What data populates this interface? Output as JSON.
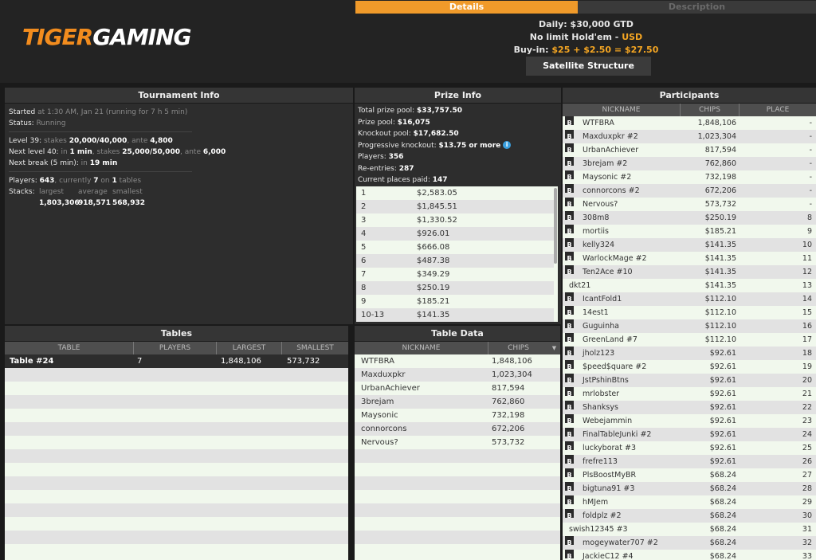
{
  "header": {
    "logo_part1": "TIGER",
    "logo_part2": "GAMING",
    "tab_details": "Details",
    "tab_description": "Description",
    "line1": "Daily: $30,000 GTD",
    "line2_game": "No limit Hold'em - ",
    "line2_currency": "USD",
    "line3_label": "Buy-in: ",
    "line3_value": "$25 + $2.50 = $27.50",
    "satellite_button": "Satellite Structure"
  },
  "tournament_info": {
    "title": "Tournament Info",
    "started_label": "Started",
    "started_value": " at 1:30 AM, Jan 21 (running for 7 h 5 min)",
    "status_label": "Status:",
    "status_value": " Running",
    "level_label": "Level 39:",
    "level_stakes_label": " stakes ",
    "level_stakes": "20,000/40,000",
    "level_ante_label": ", ante ",
    "level_ante": "4,800",
    "next_level_label": "Next level 40:",
    "next_level_in": " in ",
    "next_level_time": "1 min",
    "next_level_stakes_label": ", stakes ",
    "next_level_stakes": "25,000/50,000",
    "next_level_ante_label": ", ante ",
    "next_level_ante": "6,000",
    "next_break_label": "Next break (5 min):",
    "next_break_in": " in ",
    "next_break_time": "19 min",
    "players_label": "Players: ",
    "players_total": "643",
    "players_currently_label": ", currently ",
    "players_current": "7",
    "players_on_label": " on ",
    "players_tables": "1",
    "players_tables_label": " tables",
    "stacks_label": "Stacks:",
    "stacks_largest_label": "largest",
    "stacks_average_label": "average",
    "stacks_smallest_label": "smallest",
    "stacks_largest": "1,803,306",
    "stacks_average": "918,571",
    "stacks_smallest": "568,932"
  },
  "prize_info": {
    "title": "Prize Info",
    "total_prize_pool_label": "Total prize pool: ",
    "total_prize_pool": "$33,757.50",
    "prize_pool_label": "Prize pool: ",
    "prize_pool": "$16,075",
    "knockout_pool_label": "Knockout pool: ",
    "knockout_pool": "$17,682.50",
    "progressive_label": "Progressive knockout: ",
    "progressive_value": "$13.75 or more",
    "players_label": "Players: ",
    "players": "356",
    "reentries_label": "Re-entries: ",
    "reentries": "287",
    "places_paid_label": "Current places paid: ",
    "places_paid": "147",
    "payouts": [
      {
        "place": "1",
        "amount": "$2,583.05"
      },
      {
        "place": "2",
        "amount": "$1,845.51"
      },
      {
        "place": "3",
        "amount": "$1,330.52"
      },
      {
        "place": "4",
        "amount": "$926.01"
      },
      {
        "place": "5",
        "amount": "$666.08"
      },
      {
        "place": "6",
        "amount": "$487.38"
      },
      {
        "place": "7",
        "amount": "$349.29"
      },
      {
        "place": "8",
        "amount": "$250.19"
      },
      {
        "place": "9",
        "amount": "$185.21"
      },
      {
        "place": "10-13",
        "amount": "$141.35"
      }
    ]
  },
  "tables": {
    "title": "Tables",
    "columns": [
      "TABLE",
      "PLAYERS",
      "LARGEST",
      "SMALLEST"
    ],
    "rows": [
      {
        "table": "Table #24",
        "players": "7",
        "largest": "1,848,106",
        "smallest": "573,732"
      }
    ]
  },
  "table_data": {
    "title": "Table Data",
    "columns": [
      "NICKNAME",
      "CHIPS"
    ],
    "rows": [
      {
        "nickname": "WTFBRA",
        "chips": "1,848,106"
      },
      {
        "nickname": "Maxduxpkr",
        "chips": "1,023,304"
      },
      {
        "nickname": "UrbanAchiever",
        "chips": "817,594"
      },
      {
        "nickname": "3brejam",
        "chips": "762,860"
      },
      {
        "nickname": "Maysonic",
        "chips": "732,198"
      },
      {
        "nickname": "connorcons",
        "chips": "672,206"
      },
      {
        "nickname": "Nervous?",
        "chips": "573,732"
      }
    ]
  },
  "participants": {
    "title": "Participants",
    "columns": [
      "NICKNAME",
      "CHIPS",
      "PLACE"
    ],
    "rows": [
      {
        "b": true,
        "nickname": "WTFBRA",
        "chips": "1,848,106",
        "place": "-"
      },
      {
        "b": true,
        "nickname": "Maxduxpkr #2",
        "chips": "1,023,304",
        "place": "-"
      },
      {
        "b": true,
        "nickname": "UrbanAchiever",
        "chips": "817,594",
        "place": "-"
      },
      {
        "b": true,
        "nickname": "3brejam #2",
        "chips": "762,860",
        "place": "-"
      },
      {
        "b": true,
        "nickname": "Maysonic #2",
        "chips": "732,198",
        "place": "-"
      },
      {
        "b": true,
        "nickname": "connorcons #2",
        "chips": "672,206",
        "place": "-"
      },
      {
        "b": true,
        "nickname": "Nervous?",
        "chips": "573,732",
        "place": "-"
      },
      {
        "b": true,
        "nickname": "308m8",
        "chips": "$250.19",
        "place": "8"
      },
      {
        "b": true,
        "nickname": "mortiis",
        "chips": "$185.21",
        "place": "9"
      },
      {
        "b": true,
        "nickname": "kelly324",
        "chips": "$141.35",
        "place": "10"
      },
      {
        "b": true,
        "nickname": "WarlockMage #2",
        "chips": "$141.35",
        "place": "11"
      },
      {
        "b": true,
        "nickname": "Ten2Ace #10",
        "chips": "$141.35",
        "place": "12"
      },
      {
        "b": false,
        "nickname": "dkt21",
        "chips": "$141.35",
        "place": "13"
      },
      {
        "b": true,
        "nickname": "IcantFold1",
        "chips": "$112.10",
        "place": "14"
      },
      {
        "b": true,
        "nickname": "14est1",
        "chips": "$112.10",
        "place": "15"
      },
      {
        "b": true,
        "nickname": "Guguinha",
        "chips": "$112.10",
        "place": "16"
      },
      {
        "b": true,
        "nickname": "GreenLand #7",
        "chips": "$112.10",
        "place": "17"
      },
      {
        "b": true,
        "nickname": "jholz123",
        "chips": "$92.61",
        "place": "18"
      },
      {
        "b": true,
        "nickname": "$peed$quare #2",
        "chips": "$92.61",
        "place": "19"
      },
      {
        "b": true,
        "nickname": "JstPshinBtns",
        "chips": "$92.61",
        "place": "20"
      },
      {
        "b": true,
        "nickname": "mrlobster",
        "chips": "$92.61",
        "place": "21"
      },
      {
        "b": true,
        "nickname": "Shanksys",
        "chips": "$92.61",
        "place": "22"
      },
      {
        "b": true,
        "nickname": "Webejammin",
        "chips": "$92.61",
        "place": "23"
      },
      {
        "b": true,
        "nickname": "FinalTableJunki #2",
        "chips": "$92.61",
        "place": "24"
      },
      {
        "b": true,
        "nickname": "luckyborat #3",
        "chips": "$92.61",
        "place": "25"
      },
      {
        "b": true,
        "nickname": "frefre113",
        "chips": "$92.61",
        "place": "26"
      },
      {
        "b": true,
        "nickname": "PlsBoostMyBR",
        "chips": "$68.24",
        "place": "27"
      },
      {
        "b": true,
        "nickname": "bigtuna91 #3",
        "chips": "$68.24",
        "place": "28"
      },
      {
        "b": true,
        "nickname": "hMJem",
        "chips": "$68.24",
        "place": "29"
      },
      {
        "b": true,
        "nickname": "foldplz #2",
        "chips": "$68.24",
        "place": "30"
      },
      {
        "b": false,
        "nickname": "swish12345 #3",
        "chips": "$68.24",
        "place": "31"
      },
      {
        "b": true,
        "nickname": "mogeywater707 #2",
        "chips": "$68.24",
        "place": "32"
      },
      {
        "b": true,
        "nickname": "JackieC12 #4",
        "chips": "$68.24",
        "place": "33"
      }
    ]
  },
  "icons": {
    "bounty_letter": "B",
    "info_symbol": "i",
    "sort_icon": "▼"
  }
}
